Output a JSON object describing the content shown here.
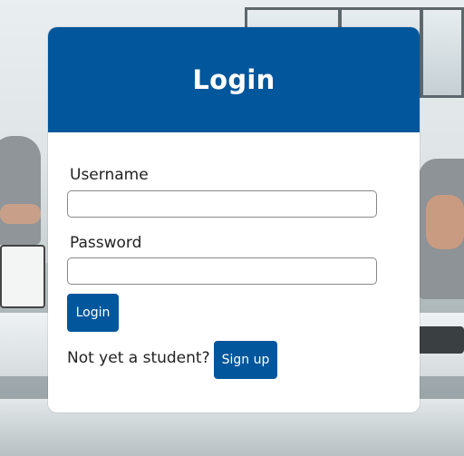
{
  "login_card": {
    "title": "Login",
    "username_label": "Username",
    "username_value": "",
    "password_label": "Password",
    "password_value": "",
    "login_button_label": "Login",
    "signup_prompt": "Not yet a student?",
    "signup_button_label": "Sign up"
  },
  "colors": {
    "brand_blue": "#02569b",
    "card_background": "#ffffff"
  }
}
